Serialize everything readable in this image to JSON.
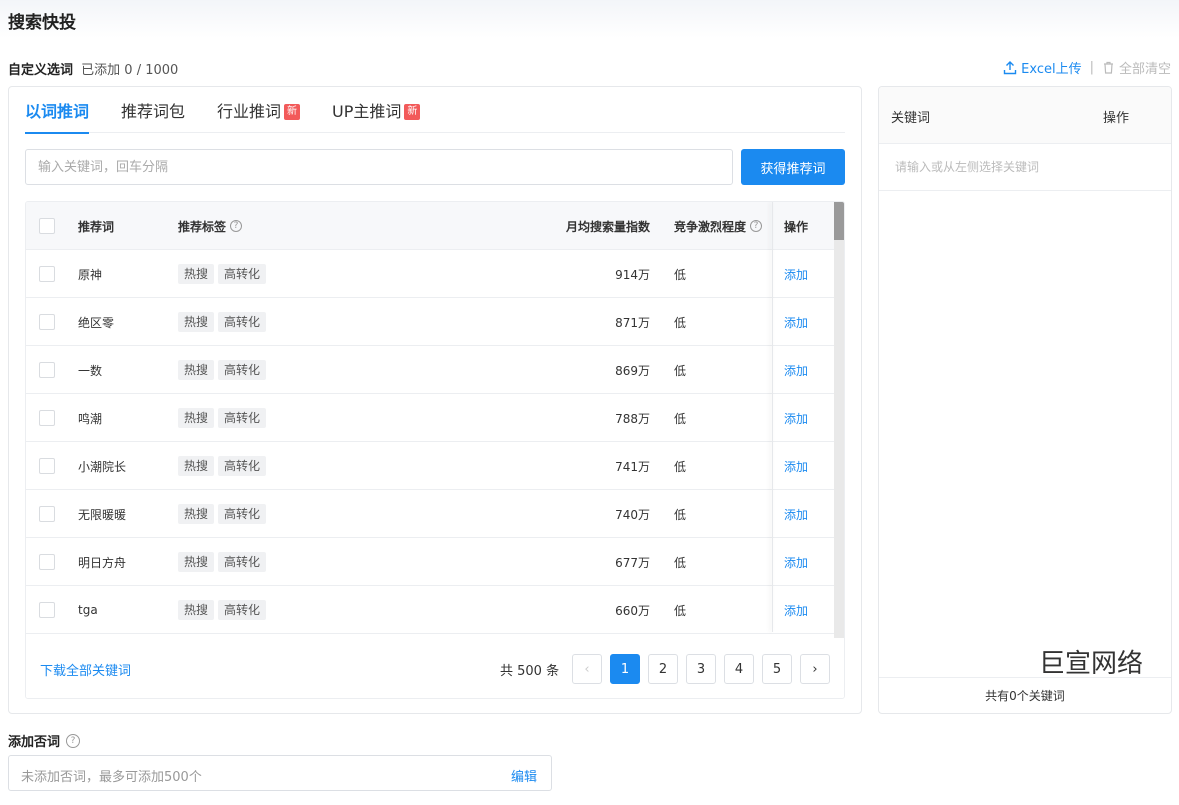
{
  "page_title": "搜索快投",
  "custom": {
    "label": "自定义选词",
    "count": "已添加 0 / 1000"
  },
  "top_actions": {
    "upload": "Excel上传",
    "separator": "|",
    "clear": "全部清空"
  },
  "tabs": [
    {
      "label": "以词推词",
      "active": true,
      "badge": ""
    },
    {
      "label": "推荐词包",
      "active": false,
      "badge": ""
    },
    {
      "label": "行业推词",
      "active": false,
      "badge": "新"
    },
    {
      "label": "UP主推词",
      "active": false,
      "badge": "新"
    }
  ],
  "search": {
    "placeholder": "输入关键词，回车分隔",
    "button": "获得推荐词"
  },
  "table": {
    "headers": {
      "word": "推荐词",
      "tags": "推荐标签",
      "volume": "月均搜索量指数",
      "competition": "竞争激烈程度",
      "action": "操作"
    },
    "rows": [
      {
        "word": "原神",
        "tags": [
          "热搜",
          "高转化"
        ],
        "volume": "914万",
        "competition": "低",
        "action": "添加"
      },
      {
        "word": "绝区零",
        "tags": [
          "热搜",
          "高转化"
        ],
        "volume": "871万",
        "competition": "低",
        "action": "添加"
      },
      {
        "word": "一数",
        "tags": [
          "热搜",
          "高转化"
        ],
        "volume": "869万",
        "competition": "低",
        "action": "添加"
      },
      {
        "word": "鸣潮",
        "tags": [
          "热搜",
          "高转化"
        ],
        "volume": "788万",
        "competition": "低",
        "action": "添加"
      },
      {
        "word": "小潮院长",
        "tags": [
          "热搜",
          "高转化"
        ],
        "volume": "741万",
        "competition": "低",
        "action": "添加"
      },
      {
        "word": "无限暖暖",
        "tags": [
          "热搜",
          "高转化"
        ],
        "volume": "740万",
        "competition": "低",
        "action": "添加"
      },
      {
        "word": "明日方舟",
        "tags": [
          "热搜",
          "高转化"
        ],
        "volume": "677万",
        "competition": "低",
        "action": "添加"
      },
      {
        "word": "tga",
        "tags": [
          "热搜",
          "高转化"
        ],
        "volume": "660万",
        "competition": "低",
        "action": "添加"
      }
    ]
  },
  "footer": {
    "download": "下载全部关键词",
    "total": "共 500 条",
    "pages": [
      "1",
      "2",
      "3",
      "4",
      "5"
    ],
    "current_page": "1",
    "prev": "‹",
    "next": "›"
  },
  "right_panel": {
    "col_keyword": "关键词",
    "col_action": "操作",
    "empty_hint": "请输入或从左侧选择关键词",
    "watermark": "巨宣网络",
    "summary": "共有0个关键词"
  },
  "negative": {
    "label": "添加否词",
    "placeholder": "未添加否词，最多可添加500个",
    "edit": "编辑"
  },
  "colors": {
    "accent": "#1b8af0",
    "badge": "#f25a5a"
  }
}
